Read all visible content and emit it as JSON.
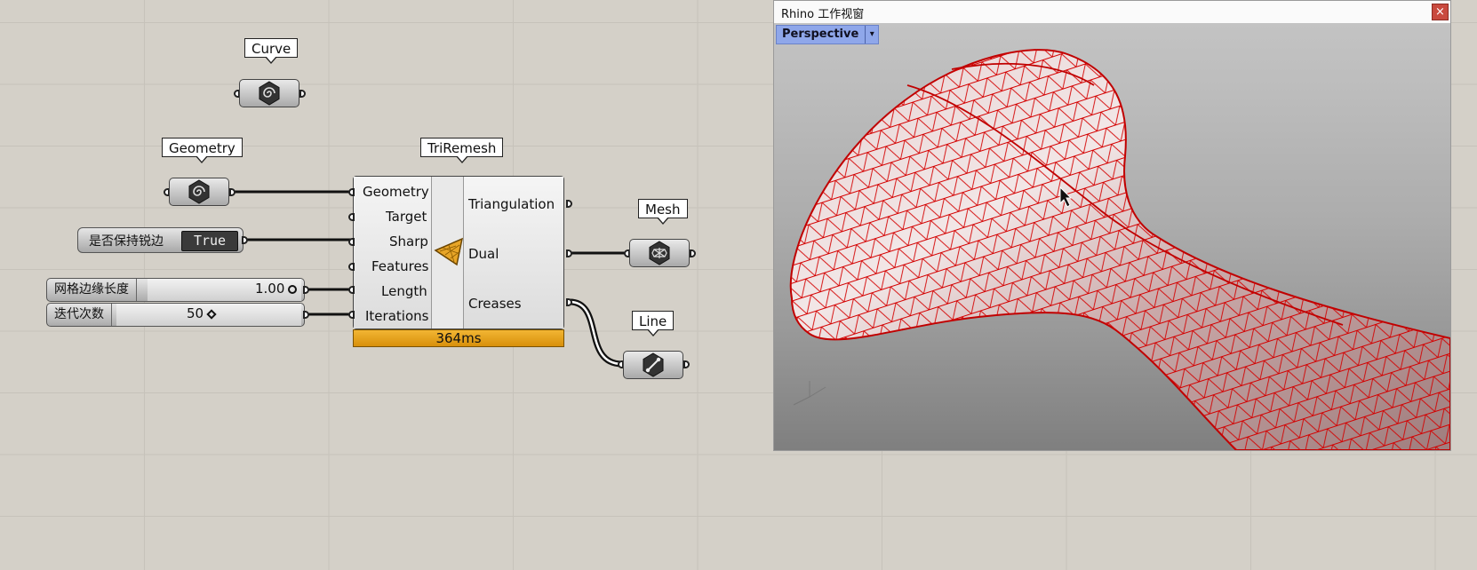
{
  "canvas": {
    "bubbles": {
      "curve": "Curve",
      "geometry": "Geometry",
      "triremesh": "TriRemesh",
      "mesh": "Mesh",
      "line": "Line"
    },
    "toggle": {
      "label": "是否保持锐边",
      "value": "True"
    },
    "sliders": [
      {
        "label": "网格边缘长度",
        "value": "1.00"
      },
      {
        "label": "迭代次数",
        "value": "50"
      }
    ],
    "component": {
      "inputs": [
        "Geometry",
        "Target",
        "Sharp",
        "Features",
        "Length",
        "Iterations"
      ],
      "outputs": [
        "Triangulation",
        "Dual",
        "Creases"
      ],
      "timer": "364ms",
      "icon": "triremesh-icon"
    }
  },
  "viewport": {
    "title": "Rhino 工作视窗",
    "close": "×",
    "view_name": "Perspective",
    "dropdown": "▾",
    "mesh_color": "#d40000",
    "tab_color": "#8fa7ea"
  },
  "colors": {
    "canvas": "#d4d0c8",
    "timer": "#e8a520"
  }
}
